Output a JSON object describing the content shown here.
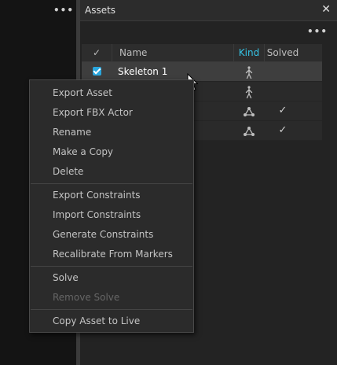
{
  "left_pane": {
    "menu_icon": "more-horizontal-icon"
  },
  "panel": {
    "title": "Assets",
    "close_glyph": "✕",
    "options_glyph": "•••"
  },
  "table": {
    "columns": {
      "check": "✓",
      "name": "Name",
      "kind": "Kind",
      "solved": "Solved"
    },
    "rows": [
      {
        "checked": true,
        "name": "Skeleton 1",
        "kind_icon": "skeleton-figure-icon",
        "solved": ""
      },
      {
        "checked": false,
        "name": "",
        "kind_icon": "skeleton-figure-icon",
        "solved": ""
      },
      {
        "checked": false,
        "name": "",
        "kind_icon": "rigid-body-icon",
        "solved": "✓"
      },
      {
        "checked": false,
        "name": "",
        "kind_icon": "rigid-body-icon",
        "solved": "✓"
      }
    ]
  },
  "context_menu": {
    "items": [
      {
        "label": "Export Asset",
        "enabled": true
      },
      {
        "label": "Export FBX Actor",
        "enabled": true
      },
      {
        "label": "Rename",
        "enabled": true
      },
      {
        "label": "Make a Copy",
        "enabled": true
      },
      {
        "label": "Delete",
        "enabled": true
      },
      {
        "label": "Export Constraints",
        "enabled": true
      },
      {
        "label": "Import Constraints",
        "enabled": true
      },
      {
        "label": "Generate Constraints",
        "enabled": true
      },
      {
        "label": "Recalibrate From Markers",
        "enabled": true
      },
      {
        "label": "Solve",
        "enabled": true
      },
      {
        "label": "Remove Solve",
        "enabled": false
      },
      {
        "label": "Copy Asset to Live",
        "enabled": true
      }
    ]
  },
  "colors": {
    "accent": "#2aa6dd",
    "kind_header": "#35c4e6"
  }
}
